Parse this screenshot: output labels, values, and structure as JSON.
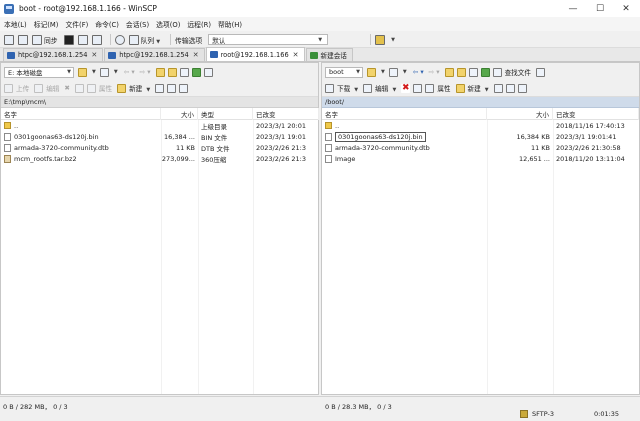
{
  "window": {
    "title": "boot - root@192.168.1.166 - WinSCP",
    "minimize_glyph": "—",
    "maximize_glyph": "☐",
    "close_glyph": "✕"
  },
  "menu": [
    "本地(L)",
    "标记(M)",
    "文件(F)",
    "命令(C)",
    "会话(S)",
    "选项(O)",
    "远程(R)",
    "帮助(H)"
  ],
  "toolbar": {
    "sync_label": "同步",
    "queue_label": "队列",
    "transfer_label": "传输选项",
    "transfer_value": "默认"
  },
  "tabs": [
    {
      "label": "htpc@192.168.1.254",
      "active": false
    },
    {
      "label": "htpc@192.168.1.254",
      "active": false
    },
    {
      "label": "root@192.168.1.166",
      "active": true
    },
    {
      "label": "新建会话",
      "active": false
    }
  ],
  "left": {
    "drive": "E: 本地磁盘",
    "upload": "上传",
    "edit": "编辑",
    "properties": "属性",
    "new": "新建",
    "path": "E:\\tmp\\mcm\\",
    "columns": [
      "名字",
      "大小",
      "类型",
      "已改变"
    ],
    "files": [
      {
        "name": "..",
        "size": "",
        "type": "上级目录",
        "changed": "2023/3/1  20:01",
        "icon": "folder"
      },
      {
        "name": "0301goonas63-ds120j.bin",
        "size": "16,384 ...",
        "type": "BIN 文件",
        "changed": "2023/3/1  19:01",
        "icon": "file"
      },
      {
        "name": "armada-3720-community.dtb",
        "size": "11 KB",
        "type": "DTB 文件",
        "changed": "2023/2/26  21:3",
        "icon": "file"
      },
      {
        "name": "mcm_rootfs.tar.bz2",
        "size": "273,099...",
        "type": "360压缩",
        "changed": "2023/2/26  21:3",
        "icon": "archive"
      }
    ],
    "status": "0 B / 282 MB，   0 / 3"
  },
  "right": {
    "drive": "boot",
    "find_files": "查找文件",
    "download": "下载",
    "edit": "编辑",
    "properties": "属性",
    "new": "新建",
    "path": "/boot/",
    "columns": [
      "名字",
      "大小",
      "已改变"
    ],
    "files": [
      {
        "name": "..",
        "size": "",
        "changed": "2018/11/16 17:40:13",
        "icon": "folder"
      },
      {
        "name": "0301goonas63-ds120j.bin",
        "size": "16,384 KB",
        "changed": "2023/3/1 19:01:41",
        "icon": "file",
        "selected": true
      },
      {
        "name": "armada-3720-community.dtb",
        "size": "11 KB",
        "changed": "2023/2/26 21:30:58",
        "icon": "file"
      },
      {
        "name": "Image",
        "size": "12,651 ...",
        "changed": "2018/11/20 13:11:04",
        "icon": "file"
      }
    ],
    "status": "0 B / 28.3 MB，   0 / 3"
  },
  "statusbar": {
    "protocol": "SFTP-3",
    "time": "0:01:35"
  }
}
